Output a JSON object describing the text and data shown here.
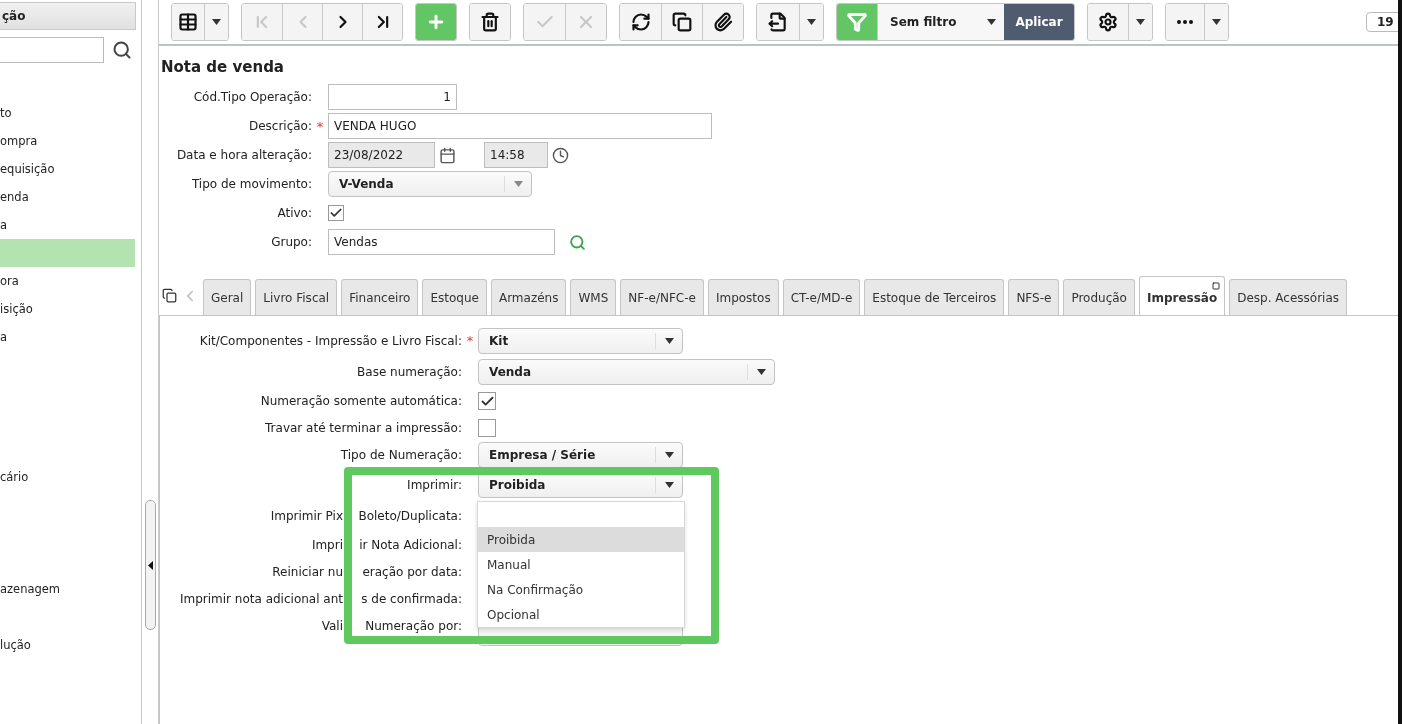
{
  "sidebar": {
    "title": "ção",
    "items": [
      {
        "label": "to",
        "selected": false
      },
      {
        "label": "ompra",
        "selected": false
      },
      {
        "label": "equisição",
        "selected": false
      },
      {
        "label": "enda",
        "selected": false
      },
      {
        "label": "a",
        "selected": false
      },
      {
        "selected": true
      },
      {
        "label": "ora",
        "selected": false
      },
      {
        "label": "isição",
        "selected": false
      },
      {
        "label": "a",
        "selected": false
      },
      {
        "selected": false
      },
      {
        "selected": false
      },
      {
        "selected": false
      },
      {
        "selected": false
      },
      {
        "label": "cário",
        "selected": false
      },
      {
        "selected": false
      },
      {
        "selected": false
      },
      {
        "selected": false
      },
      {
        "label": "azenagem",
        "selected": false
      },
      {
        "selected": false
      },
      {
        "label": "lução",
        "selected": false
      }
    ]
  },
  "toolbar": {
    "buttons": [
      {
        "disabled": false
      },
      {
        "disabled": false
      },
      {
        "disabled": true
      },
      {
        "disabled": true
      },
      {
        "disabled": false
      },
      {
        "disabled": false
      },
      {
        "disabled": false
      },
      {
        "disabled": false
      },
      {
        "disabled": true
      },
      {
        "disabled": true
      },
      {
        "disabled": false
      },
      {
        "disabled": false
      },
      {
        "disabled": false
      },
      {
        "disabled": false
      },
      {
        "disabled": false
      },
      {
        "disabled": false
      },
      {
        "disabled": false
      },
      {
        "disabled": false
      },
      {
        "disabled": false
      },
      {
        "disabled": false
      }
    ],
    "filter": {
      "value": "Sem filtro",
      "apply": "Aplicar"
    },
    "page": "19"
  },
  "form": {
    "title": "Nota de venda",
    "fields": [
      {
        "label": "Cód.Tipo Operação:",
        "kind": "number",
        "value": "1"
      },
      {
        "label": "Descrição:",
        "kind": "text",
        "value": "VENDA HUGO",
        "required_mark": "*"
      },
      {
        "label": "Data e hora alteração:",
        "kind": "datetime",
        "date": "23/08/2022",
        "time": "14:58",
        "disabled": true
      },
      {
        "label": "Tipo de movimento:",
        "kind": "select",
        "value": "V-Venda"
      },
      {
        "label": "Ativo:",
        "kind": "checkbox",
        "checked": true
      },
      {
        "label": "Grupo:",
        "kind": "lookup",
        "value": "Vendas"
      }
    ]
  },
  "tabs": [
    {
      "label": "Geral",
      "selected": false
    },
    {
      "label": "Livro Fiscal",
      "selected": false
    },
    {
      "label": "Financeiro",
      "selected": false
    },
    {
      "label": "Estoque",
      "selected": false
    },
    {
      "label": "Armazéns",
      "selected": false
    },
    {
      "label": "WMS",
      "selected": false
    },
    {
      "label": "NF-e/NFC-e",
      "selected": false
    },
    {
      "label": "Impostos",
      "selected": false
    },
    {
      "label": "CT-e/MD-e",
      "selected": false
    },
    {
      "label": "Estoque de Terceiros",
      "selected": false
    },
    {
      "label": "NFS-e",
      "selected": false
    },
    {
      "label": "Produção",
      "selected": false
    },
    {
      "label": "Impressão",
      "selected": true
    },
    {
      "label": "Desp. Acessórias",
      "selected": false
    }
  ],
  "panel": {
    "fields": [
      {
        "label_parts": [
          "Kit/Componentes - Impressão e Livro Fiscal:"
        ],
        "kind": "select",
        "value": "Kit",
        "required_mark": "*"
      },
      {
        "label_parts": [
          "Base numeração:"
        ],
        "kind": "wide-select",
        "value": "Venda"
      },
      {
        "label_parts": [
          "Numeração somente automática:"
        ],
        "kind": "checkbox",
        "checked": true
      },
      {
        "label_parts": [
          "Travar até terminar a impressão:"
        ],
        "kind": "checkbox",
        "checked": false
      },
      {
        "label_parts": [
          "Tipo de Numeração:"
        ],
        "kind": "select",
        "value": "Empresa / Série"
      },
      {
        "label_parts": [
          "Imprimir:"
        ],
        "kind": "select",
        "value": "Proibida"
      },
      {
        "label_parts": [
          "Imprimir Pix",
          "Boleto/Duplicata:"
        ],
        "kind": "covered"
      },
      {
        "label_parts": [
          "Impri",
          "ir Nota Adicional:"
        ],
        "kind": "covered"
      },
      {
        "label_parts": [
          "Reiniciar nu",
          "eração por data:"
        ],
        "kind": "covered"
      },
      {
        "label_parts": [
          "Imprimir nota adicional ant",
          "s de confirmada:"
        ],
        "kind": "covered"
      },
      {
        "label_parts": [
          "Vali",
          "Numeração por:"
        ],
        "kind": "blank-select"
      }
    ],
    "dropdown": {
      "options": [
        {
          "label": "Proibida",
          "selected": true
        },
        {
          "label": "Manual",
          "selected": false
        },
        {
          "label": "Na Confirmação",
          "selected": false
        },
        {
          "label": "Opcional",
          "selected": false
        }
      ]
    }
  }
}
